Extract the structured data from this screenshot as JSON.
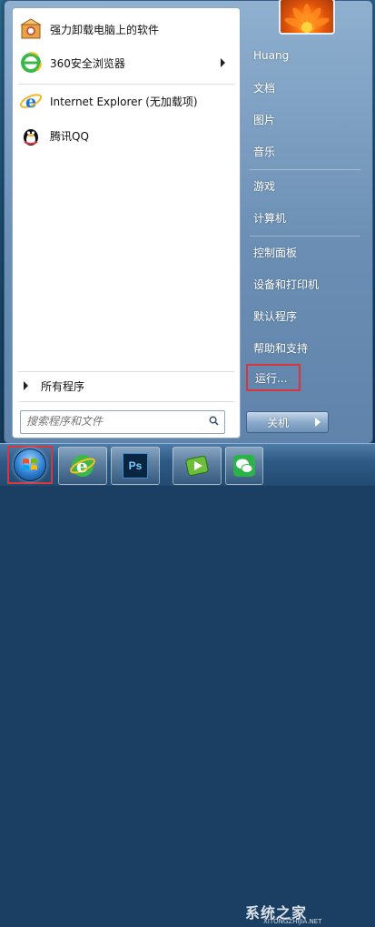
{
  "start_menu": {
    "programs": [
      {
        "label": "强力卸载电脑上的软件",
        "icon": "uninstall-box-icon"
      },
      {
        "label": "360安全浏览器",
        "icon": "360-browser-icon",
        "has_submenu": true
      },
      {
        "label": "Internet Explorer (无加载项)",
        "icon": "internet-explorer-icon"
      },
      {
        "label": "腾讯QQ",
        "icon": "qq-penguin-icon"
      }
    ],
    "all_programs_label": "所有程序",
    "search": {
      "placeholder": "搜索程序和文件"
    },
    "right_items": [
      {
        "label": "Huang"
      },
      {
        "label": "文档"
      },
      {
        "label": "图片"
      },
      {
        "label": "音乐"
      },
      {
        "label": "游戏"
      },
      {
        "label": "计算机"
      },
      {
        "label": "控制面板"
      },
      {
        "label": "设备和打印机"
      },
      {
        "label": "默认程序"
      },
      {
        "label": "帮助和支持"
      },
      {
        "label": "运行..."
      }
    ],
    "shutdown_label": "关机"
  },
  "taskbar": {
    "apps": [
      {
        "name": "start-button"
      },
      {
        "name": "360-browser-icon"
      },
      {
        "name": "photoshop-icon",
        "label": "Ps"
      },
      {
        "name": "media-player-icon"
      },
      {
        "name": "wechat-icon"
      }
    ]
  },
  "watermark": {
    "text": "系统之家",
    "sub": "XITONGZHIJIA.NET"
  },
  "colors": {
    "highlight_red": "#d9363b",
    "menu_blue": "#6b8fb4"
  }
}
